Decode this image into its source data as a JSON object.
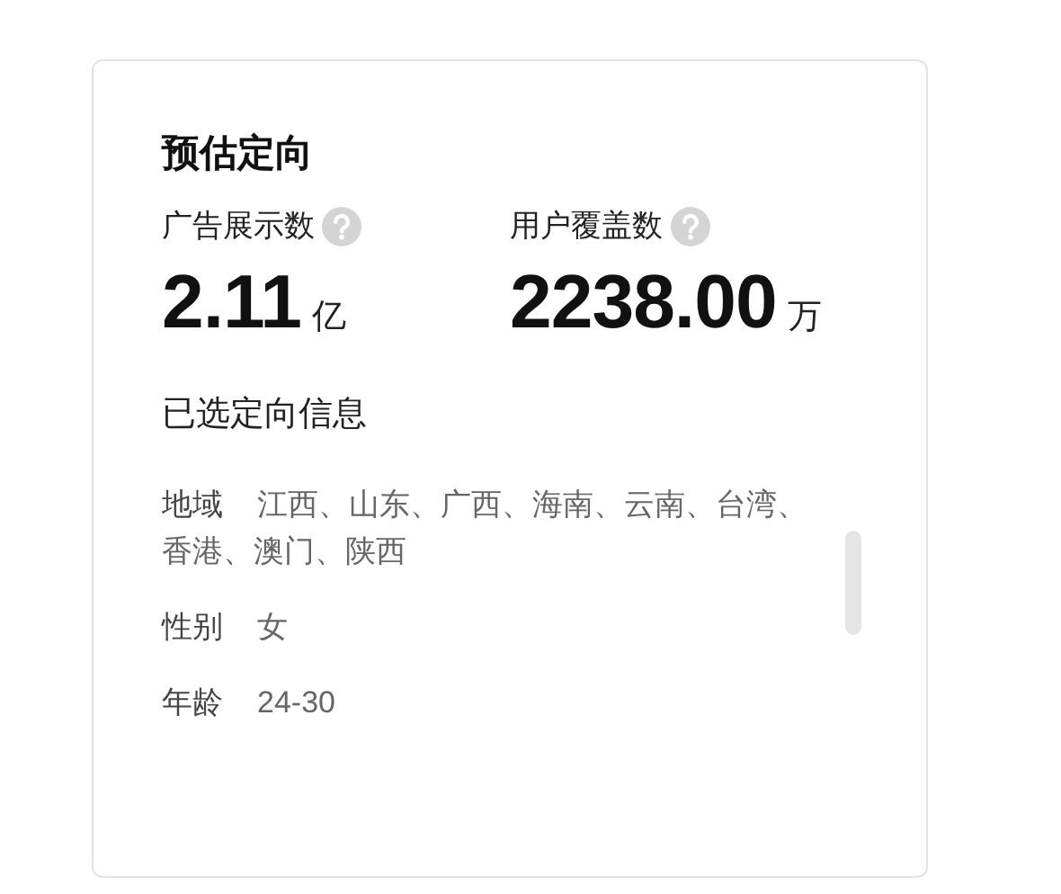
{
  "title": "预估定向",
  "metrics": [
    {
      "label": "广告展示数",
      "value": "2.11",
      "unit": "亿"
    },
    {
      "label": "用户覆盖数",
      "value": "2238.00",
      "unit": "万"
    }
  ],
  "selected_info": {
    "heading": "已选定向信息",
    "rows": [
      {
        "label": "地域",
        "value": "江西、山东、广西、海南、云南、台湾、香港、澳门、陕西"
      },
      {
        "label": "性别",
        "value": "女"
      },
      {
        "label": "年龄",
        "value": "24-30"
      }
    ]
  }
}
